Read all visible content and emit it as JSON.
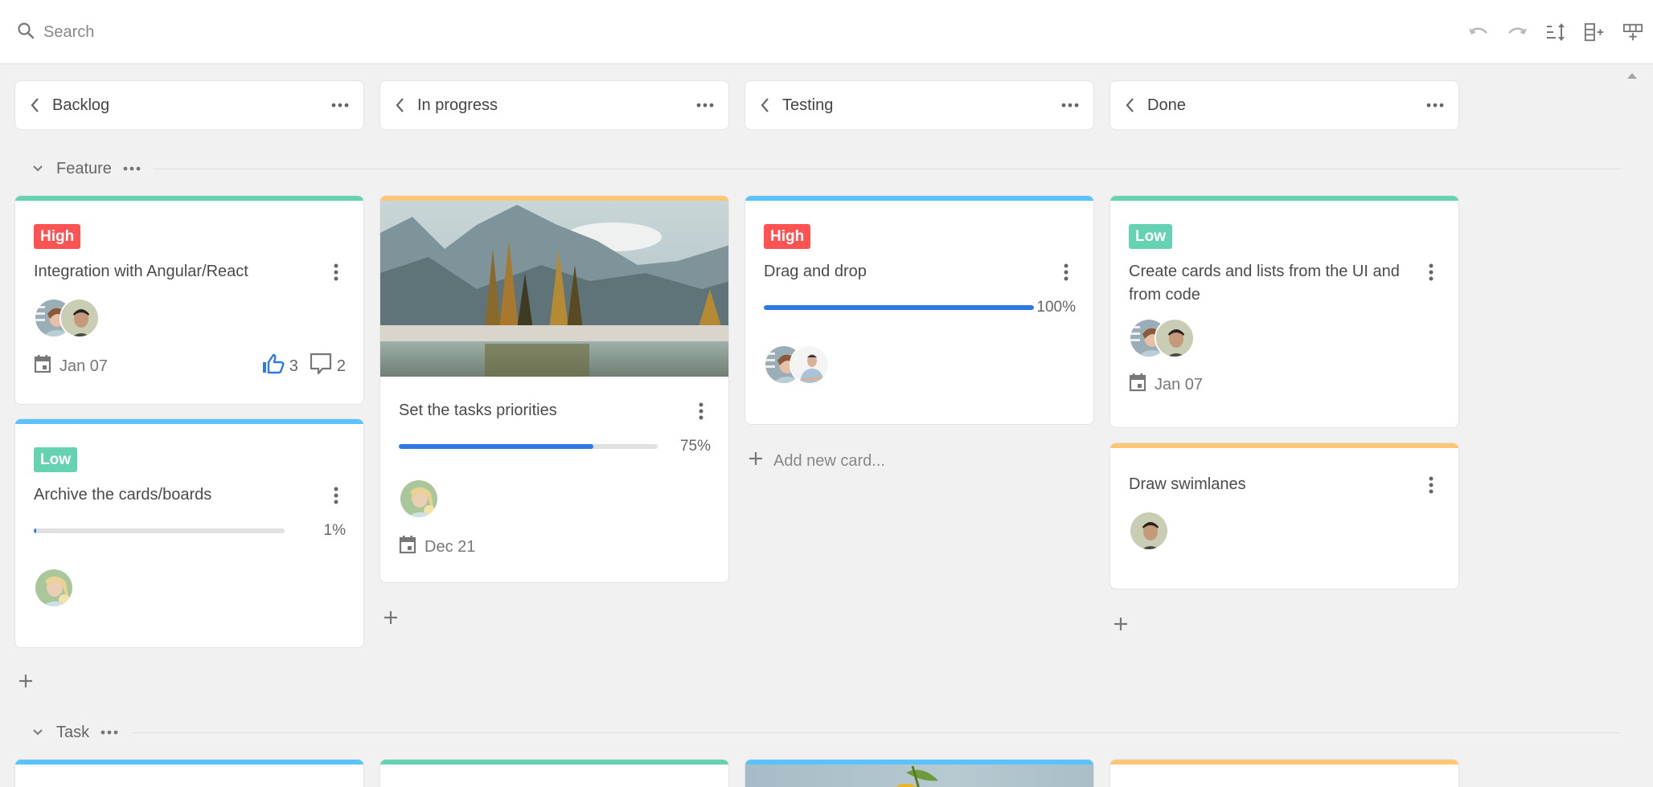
{
  "toolbar": {
    "search_placeholder": "Search",
    "icons": [
      "undo-icon",
      "redo-icon",
      "sort-icon",
      "add-column-icon",
      "add-row-icon"
    ]
  },
  "columns": [
    {
      "title": "Backlog"
    },
    {
      "title": "In progress"
    },
    {
      "title": "Testing"
    },
    {
      "title": "Done"
    }
  ],
  "swimlanes": [
    {
      "label": "Feature"
    },
    {
      "label": "Task"
    }
  ],
  "colors": {
    "high": "#ff5252",
    "low": "#65d3b2",
    "stripe_teal": "#65d3b2",
    "stripe_blue": "#58c3fe",
    "stripe_orange": "#ffc775",
    "progress": "#2e78e4",
    "like": "#2e78e4"
  },
  "cards": {
    "backlog_1": {
      "priority": "High",
      "title": "Integration with Angular/React",
      "date": "Jan 07",
      "likes": "3",
      "comments": "2"
    },
    "backlog_2": {
      "priority": "Low",
      "title": "Archive the cards/boards",
      "progress": 1,
      "progress_label": "1%"
    },
    "inprogress_1": {
      "title": "Set the tasks priorities",
      "progress": 75,
      "progress_label": "75%",
      "date": "Dec 21"
    },
    "testing_1": {
      "priority": "High",
      "title": "Drag and drop",
      "progress": 100,
      "progress_label": "100%"
    },
    "done_1": {
      "priority": "Low",
      "title": "Create cards and lists from the UI and from code",
      "date": "Jan 07"
    },
    "done_2": {
      "title": "Draw swimlanes"
    }
  },
  "add_new_card_label": "Add new card..."
}
